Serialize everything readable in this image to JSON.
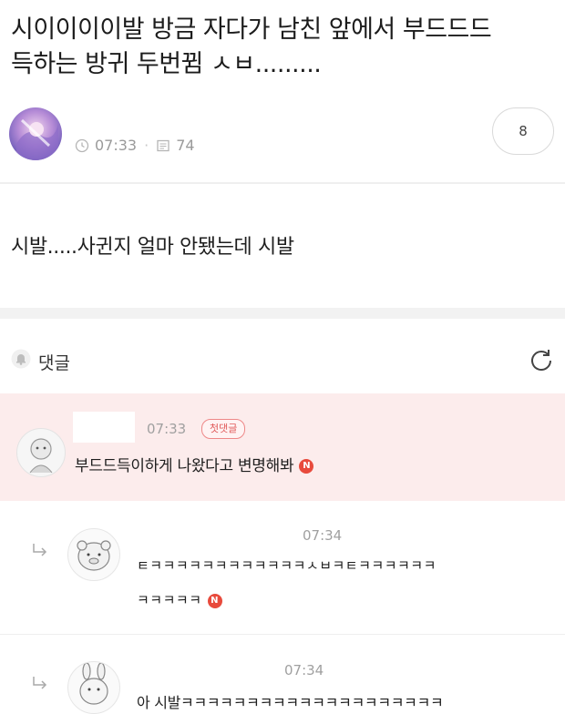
{
  "post": {
    "title": "시이이이이발 방금 자다가 남친 앞에서 부드드드\n득하는 방귀 두번뀜 ㅅㅂ.........",
    "time": "07:33",
    "views": "74",
    "comment_count": "8",
    "body": "시발.....사귄지 얼마 안됐는데 시발"
  },
  "comments_header": {
    "label": "댓글"
  },
  "comments": [
    {
      "time": "07:33",
      "badge": "첫댓글",
      "text": "부드드득이하게 나왔다고 변명해봐",
      "new_badge": "N"
    },
    {
      "time": "07:34",
      "text_line1": "ㅌㅋㅋㅋㅋㅋㅋㅋㅋㅋㅋㅋㅋㅅㅂㅋㅌㅋㅋㅋㅋㅋㅋ",
      "text_line2": "ㅋㅋㅋㅋㅋ",
      "new_badge": "N"
    },
    {
      "time": "07:34",
      "text": "아 시발ㅋㅋㅋㅋㅋㅋㅋㅋㅋㅋㅋㅋㅋㅋㅋㅋㅋㅋㅋㅋ"
    }
  ],
  "colors": {
    "highlight_bg": "#fcecec",
    "new_badge": "#e84a3c",
    "first_badge": "#e05a5a"
  }
}
